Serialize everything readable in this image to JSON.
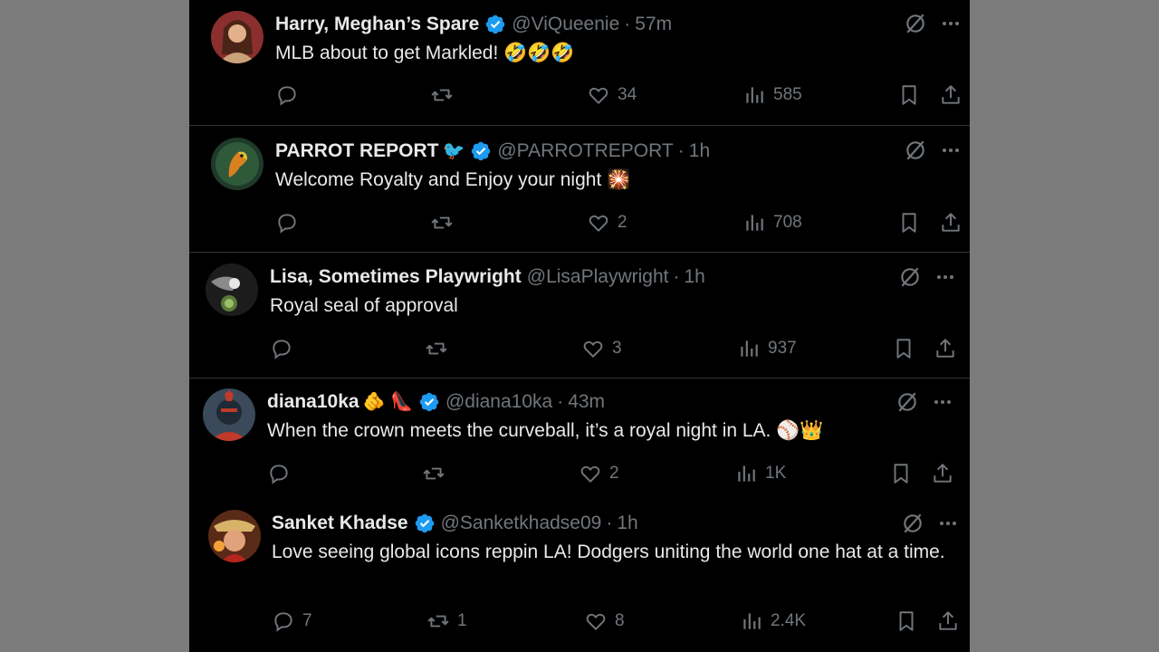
{
  "tweets": [
    {
      "name": "Harry, Meghan’s Spare",
      "name_emoji": "",
      "verified": true,
      "handle": "@ViQueenie",
      "time": "57m",
      "text": "MLB about to get Markled! 🤣🤣🤣",
      "replies": "",
      "retweets": "",
      "likes": "34",
      "views": "585"
    },
    {
      "name": "PARROT REPORT",
      "name_emoji": "🐦",
      "verified": true,
      "handle": "@PARROTREPORT",
      "time": "1h",
      "text": "Welcome Royalty and Enjoy your night 🎇",
      "replies": "",
      "retweets": "",
      "likes": "2",
      "views": "708"
    },
    {
      "name": "Lisa, Sometimes Playwright",
      "name_emoji": "",
      "verified": false,
      "handle": "@LisaPlaywright",
      "time": "1h",
      "text": "Royal seal of approval",
      "replies": "",
      "retweets": "",
      "likes": "3",
      "views": "937"
    },
    {
      "name": "diana10ka",
      "name_emoji": "🫵 👠",
      "verified": true,
      "handle": "@diana10ka",
      "time": "43m",
      "text": "When the crown meets the curveball, it’s a royal night in LA. ⚾👑",
      "replies": "",
      "retweets": "",
      "likes": "2",
      "views": "1K"
    },
    {
      "name": "Sanket Khadse",
      "name_emoji": "",
      "verified": true,
      "handle": "@Sanketkhadse09",
      "time": "1h",
      "text": "Love seeing global icons reppin LA! Dodgers uniting the world one hat at a time.",
      "replies": "7",
      "retweets": "1",
      "likes": "8",
      "views": "2.4K"
    }
  ],
  "dot": "·",
  "colors": {
    "background": "#000000",
    "text": "#e7e9ea",
    "muted": "#71767b",
    "verified": "#1d9bf0",
    "divider": "#2f3336"
  },
  "icons": [
    "reply-icon",
    "retweet-icon",
    "like-icon",
    "views-icon",
    "bookmark-icon",
    "share-icon",
    "grok-icon",
    "more-icon",
    "verified-badge-icon"
  ]
}
